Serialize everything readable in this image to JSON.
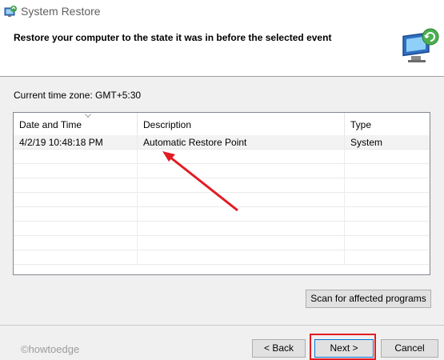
{
  "window": {
    "title": "System Restore",
    "icons": {
      "title": "system-restore-icon",
      "header": "restore-monitor-icon"
    }
  },
  "header": {
    "instruction": "Restore your computer to the state it was in before the selected event"
  },
  "timezone": {
    "label": "Current time zone: GMT+5:30"
  },
  "table": {
    "columns": [
      "Date and Time",
      "Description",
      "Type"
    ],
    "sort_indicator": "chevron-down-icon",
    "rows": [
      {
        "date": "4/2/19 10:48:18 PM",
        "description": "Automatic Restore Point",
        "type": "System",
        "selected": true
      }
    ]
  },
  "buttons": {
    "scan": "Scan for affected programs",
    "back": "< Back",
    "next": "Next >",
    "cancel": "Cancel"
  },
  "annotation": {
    "arrow_color": "#e31b23",
    "highlight_color": "#e31b23"
  },
  "watermark": {
    "text": "©howtoedge"
  }
}
